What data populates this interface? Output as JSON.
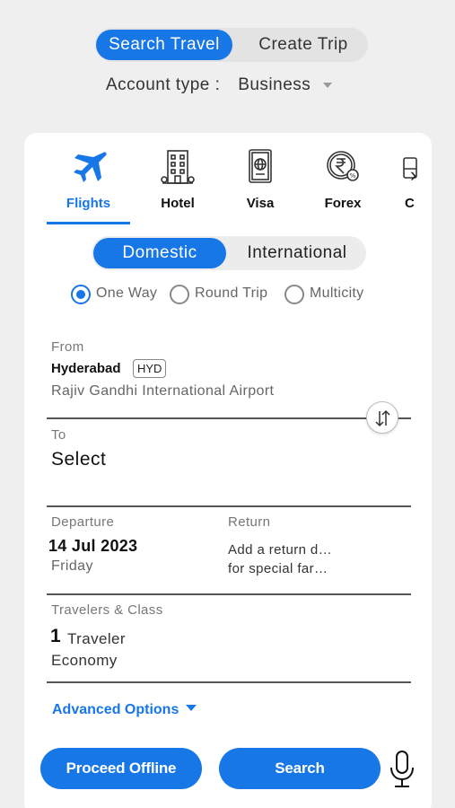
{
  "mode_toggle": {
    "active": "Search Travel",
    "inactive": "Create Trip"
  },
  "account": {
    "label": "Account type :",
    "value": "Business"
  },
  "categories": [
    {
      "label": "Flights",
      "icon": "airplane-icon",
      "active": true
    },
    {
      "label": "Hotel",
      "icon": "building-icon",
      "active": false
    },
    {
      "label": "Visa",
      "icon": "passport-icon",
      "active": false
    },
    {
      "label": "Forex",
      "icon": "rupee-coin-icon",
      "active": false
    },
    {
      "label": "C",
      "icon": "bus-icon",
      "active": false
    }
  ],
  "trip_scope": {
    "active": "Domestic",
    "inactive": "International"
  },
  "trip_types": [
    {
      "label": "One Way",
      "checked": true
    },
    {
      "label": "Round Trip",
      "checked": false
    },
    {
      "label": "Multicity",
      "checked": false
    }
  ],
  "from": {
    "label": "From",
    "city": "Hyderabad",
    "code": "HYD",
    "airport": "Rajiv Gandhi International Airport"
  },
  "to": {
    "label": "To",
    "value": "Select"
  },
  "departure": {
    "label": "Departure",
    "date": "14 Jul 2023",
    "day": "Friday"
  },
  "return": {
    "label": "Return",
    "line1": "Add a return d…",
    "line2": "for special far…"
  },
  "travelers": {
    "label": "Travelers & Class",
    "count": "1",
    "word": "Traveler",
    "class": "Economy"
  },
  "advanced_options": "Advanced Options",
  "buttons": {
    "offline": "Proceed Offline",
    "search": "Search"
  },
  "colors": {
    "accent": "#1877e6",
    "background": "#efefef",
    "card": "#ffffff"
  }
}
